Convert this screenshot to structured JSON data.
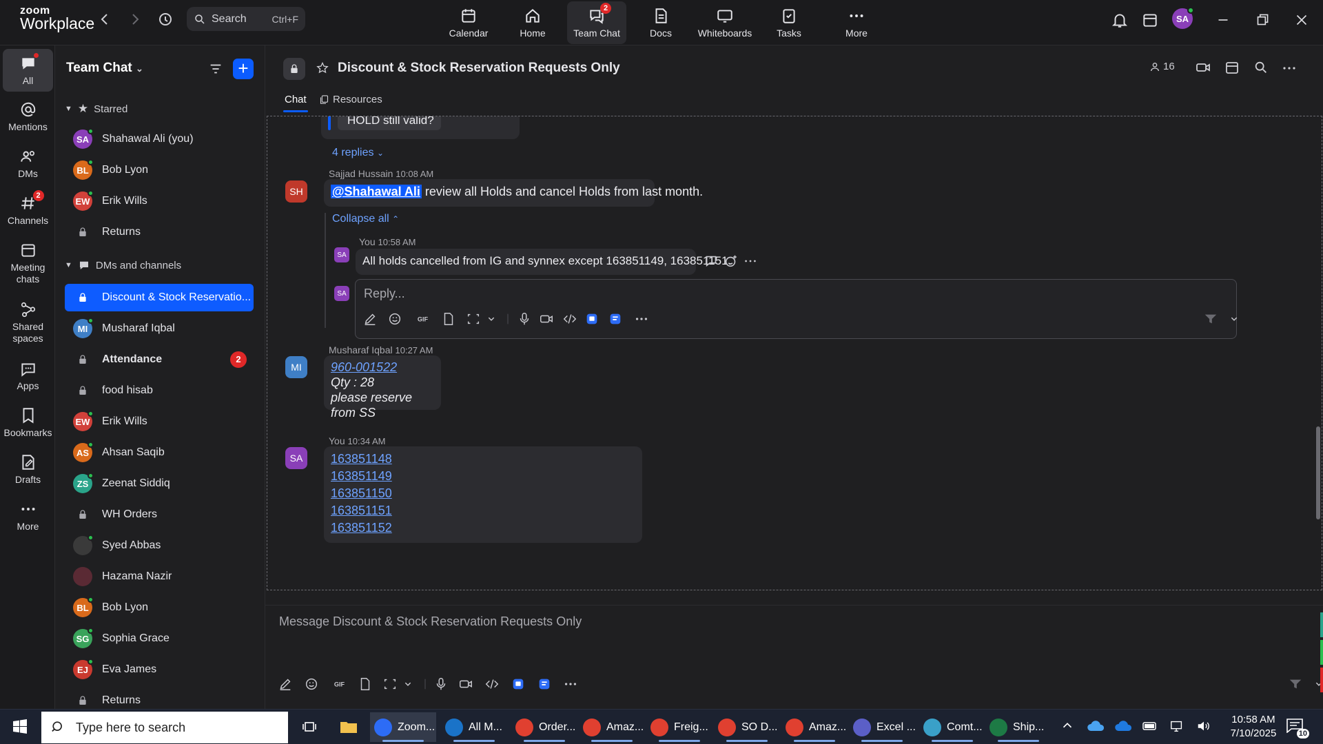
{
  "app": {
    "brand_small": "zoom",
    "brand_large": "Workplace"
  },
  "search": {
    "placeholder": "Search",
    "shortcut": "Ctrl+F"
  },
  "tabs": [
    {
      "label": "Calendar",
      "icon": "calendar-icon"
    },
    {
      "label": "Home",
      "icon": "home-icon"
    },
    {
      "label": "Team Chat",
      "icon": "chat-icon",
      "badge": "2"
    },
    {
      "label": "Docs",
      "icon": "docs-icon"
    },
    {
      "label": "Whiteboards",
      "icon": "whiteboard-icon"
    },
    {
      "label": "Tasks",
      "icon": "tasks-icon"
    },
    {
      "label": "More",
      "icon": "more-icon"
    }
  ],
  "user": {
    "initials": "SA",
    "avatar_color": "#8a3fb8"
  },
  "rail": [
    {
      "label": "All",
      "icon": "chat-icon"
    },
    {
      "label": "Mentions",
      "icon": "at-icon"
    },
    {
      "label": "DMs",
      "icon": "people-icon"
    },
    {
      "label": "Channels",
      "icon": "hash-icon",
      "badge": "2"
    },
    {
      "label": "Meeting chats",
      "icon": "calendar-icon"
    },
    {
      "label": "Shared spaces",
      "icon": "share-icon"
    },
    {
      "label": "Apps",
      "icon": "apps-icon"
    },
    {
      "label": "Bookmarks",
      "icon": "bookmark-icon"
    },
    {
      "label": "Drafts",
      "icon": "drafts-icon"
    },
    {
      "label": "More",
      "icon": "more-icon"
    }
  ],
  "sidebar": {
    "title": "Team Chat",
    "starred_label": "Starred",
    "dms_label": "DMs and channels",
    "starred": [
      {
        "name": "Shahawal Ali (you)",
        "initials": "SA",
        "color": "#8a3fb8",
        "online": true
      },
      {
        "name": "Bob Lyon",
        "initials": "BL",
        "color": "#d96a1b",
        "online": true
      },
      {
        "name": "Erik Wills",
        "initials": "EW",
        "color": "#d1413a",
        "online": true
      },
      {
        "name": "Returns",
        "lock": true
      }
    ],
    "channels": [
      {
        "name": "Discount & Stock Reservatio...",
        "lock": true,
        "selected": true
      },
      {
        "name": "Musharaf Iqbal",
        "initials": "MI",
        "color": "#3f7fc6",
        "online": true
      },
      {
        "name": "Attendance",
        "lock": true,
        "bold": true,
        "count": "2"
      },
      {
        "name": "food hisab",
        "lock": true
      },
      {
        "name": "Erik Wills",
        "initials": "EW",
        "color": "#d1413a",
        "online": true
      },
      {
        "name": "Ahsan Saqib",
        "initials": "AS",
        "color": "#d96a1b",
        "online": true
      },
      {
        "name": "Zeenat Siddiq",
        "initials": "ZS",
        "color": "#2aa48a",
        "online": true
      },
      {
        "name": "WH Orders",
        "lock": true
      },
      {
        "name": "Syed Abbas",
        "initials": "",
        "color": "#3a3a3a",
        "online": true
      },
      {
        "name": "Hazama Nazir",
        "initials": "",
        "color": "#5a2a34",
        "online": false
      },
      {
        "name": "Bob Lyon",
        "initials": "BL",
        "color": "#d96a1b",
        "online": true
      },
      {
        "name": "Sophia Grace",
        "initials": "SG",
        "color": "#3aa35b",
        "online": true
      },
      {
        "name": "Eva James",
        "initials": "EJ",
        "color": "#c93a2f",
        "online": true
      },
      {
        "name": "Returns",
        "lock": true
      }
    ]
  },
  "channel": {
    "title": "Discount & Stock Reservation Requests Only",
    "members": "16",
    "tab_chat": "Chat",
    "tab_resources": "Resources"
  },
  "messages": {
    "prev_fragment": "HOLD still valid?",
    "replies_label": "4 replies",
    "m1": {
      "sender": "Sajjad Hussain",
      "time": "10:08 AM",
      "initials": "SH",
      "color": "#c0392b",
      "mention": "@Shahawal Ali",
      "text": " review all Holds and cancel Holds from last month."
    },
    "collapse_label": "Collapse all",
    "reply": {
      "sender": "You",
      "time": "10:58 AM",
      "initials": "SA",
      "text": "All holds cancelled from IG and synnex except 163851149, 163851151."
    },
    "reply_placeholder": "Reply...",
    "m2": {
      "sender": "Musharaf Iqbal",
      "time": "10:27 AM",
      "initials": "MI",
      "link": "960-001522",
      "line2": "Qty : 28",
      "line3": "please reserve from SS"
    },
    "m3": {
      "sender": "You",
      "time": "10:34 AM",
      "initials": "SA",
      "links": [
        "163851148",
        "163851149",
        "163851150",
        "163851151",
        "163851152"
      ]
    }
  },
  "composer": {
    "placeholder": "Message Discount & Stock Reservation Requests Only"
  },
  "taskbar": {
    "search_placeholder": "Type here to search",
    "apps": [
      {
        "label": "Zoom...",
        "icon": "zoom-icon",
        "color": "#2d6cf6"
      },
      {
        "label": "All M...",
        "icon": "outlook-icon",
        "color": "#1a73c8"
      },
      {
        "label": "Order...",
        "icon": "chrome-icon",
        "color": "#e04030"
      },
      {
        "label": "Amaz...",
        "icon": "chrome-icon",
        "color": "#e04030"
      },
      {
        "label": "Freig...",
        "icon": "chrome-icon",
        "color": "#e04030"
      },
      {
        "label": "SO D...",
        "icon": "chrome-icon",
        "color": "#e04030"
      },
      {
        "label": "Amaz...",
        "icon": "chrome-icon",
        "color": "#e04030"
      },
      {
        "label": "Excel ...",
        "icon": "teams-icon",
        "color": "#5b5fc7"
      },
      {
        "label": "Comt...",
        "icon": "app-icon",
        "color": "#3aa0c8"
      },
      {
        "label": "Ship...",
        "icon": "excel-icon",
        "color": "#1d7a45"
      }
    ],
    "time": "10:58 AM",
    "date": "7/10/2025",
    "notifications": "10"
  }
}
